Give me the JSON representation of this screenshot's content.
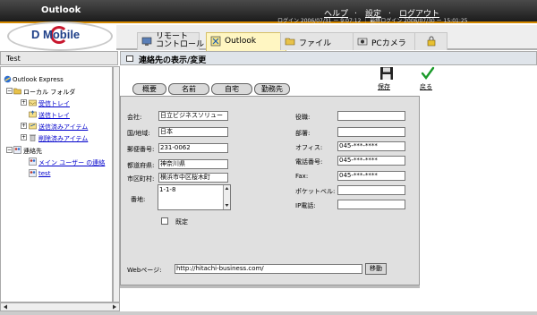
{
  "header": {
    "title": "Outlook",
    "links": {
      "help": "ヘルプ",
      "settings": "設定",
      "logout": "ログアウト"
    },
    "separator": ".",
    "login_info": "ログイン 2006/07/31 ー 9:07:12 ｜ 最終ログイン 2006/07/30 ー 15:01:25",
    "logo_text": "D  Mobile"
  },
  "tabs": [
    {
      "label_line1": "リモート",
      "label_line2": "コントロール",
      "icon": "remote-icon"
    },
    {
      "label": "Outlook",
      "icon": "outlook-icon",
      "active": true
    },
    {
      "label": "ファイル",
      "icon": "folder-icon"
    },
    {
      "label": "PCカメラ",
      "icon": "camera-icon"
    },
    {
      "label": "",
      "icon": "lock-icon"
    }
  ],
  "left": {
    "header": "Test",
    "tree": {
      "root": "Outlook Express",
      "local": "ローカル フォルダ",
      "inbox": "受信トレイ",
      "outbox": "送信トレイ",
      "sent": "送信済みアイテム",
      "deleted": "削除済みアイテム",
      "contacts": "連絡先",
      "main_user": "メイン ユーザー の連絡",
      "test": "test"
    }
  },
  "panel": {
    "title": "連絡先の表示/変更",
    "subtabs": {
      "overview": "概要",
      "name": "名前",
      "home": "自宅",
      "work": "勤務先"
    },
    "save_label": "保存",
    "back_label": "戻る"
  },
  "form": {
    "company_label": "会社:",
    "company_value": "日立ビジネスソリュー",
    "country_label": "国/地域:",
    "country_value": "日本",
    "zip_label": "郵便番号:",
    "zip_value": "231-0062",
    "pref_label": "都道府県:",
    "pref_value": "神奈川県",
    "city_label": "市区町村:",
    "city_value": "横浜市中区桜木町",
    "street_label": "番地:",
    "street_value": "1-1-8",
    "default_label": "既定",
    "title_label": "役職:",
    "title_value": "",
    "dept_label": "部署:",
    "dept_value": "",
    "office_label": "オフィス:",
    "office_value": "045-***-****",
    "phone_label": "電話番号:",
    "phone_value": "045-***-****",
    "fax_label": "Fax:",
    "fax_value": "045-***-****",
    "pager_label": "ポケットベル:",
    "pager_value": "",
    "ip_label": "IP電話:",
    "ip_value": "",
    "web_label": "Webページ:",
    "web_value": "http://hitachi-business.com/",
    "go_label": "移動"
  }
}
